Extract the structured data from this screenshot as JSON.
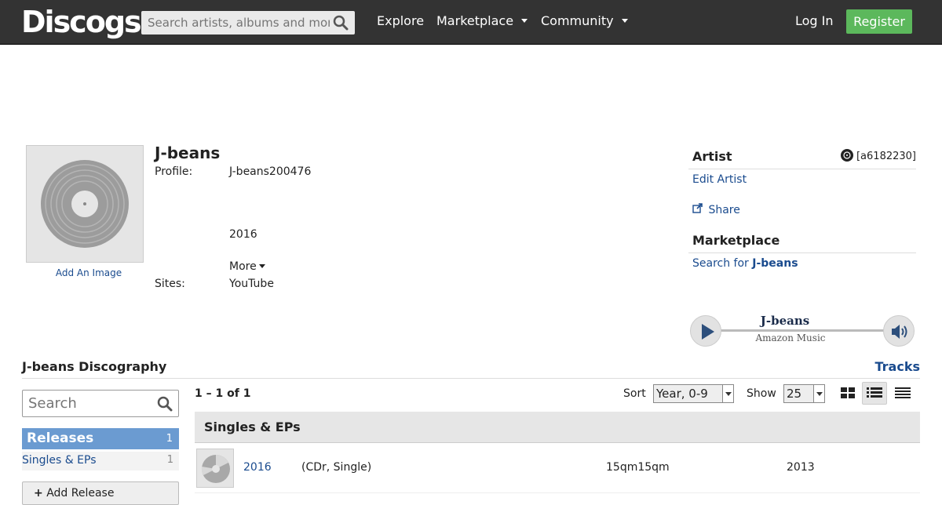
{
  "header": {
    "logo": "Discogs",
    "search_placeholder": "Search artists, albums and more...",
    "nav": [
      {
        "label": "Explore",
        "has_caret": false
      },
      {
        "label": "Marketplace",
        "has_caret": true
      },
      {
        "label": "Community",
        "has_caret": true
      }
    ],
    "login": "Log In",
    "register": "Register"
  },
  "artist": {
    "name": "J-beans",
    "add_image": "Add An Image",
    "profile_label": "Profile:",
    "profile_value": "J-beans200476",
    "profile_year": "2016",
    "more": "More",
    "sites_label": "Sites:",
    "sites_value": "YouTube"
  },
  "sidebar": {
    "artist_heading": "Artist",
    "artist_id": "[a6182230]",
    "edit_artist": "Edit Artist",
    "share": "Share",
    "marketplace_heading": "Marketplace",
    "search_for": "Search for",
    "search_for_name": "J-beans"
  },
  "player": {
    "title": "J-beans",
    "subtitle": "Amazon Music"
  },
  "discography": {
    "title": "J-beans Discography",
    "tracks_link": "Tracks",
    "search_placeholder": "Search",
    "releases_label": "Releases",
    "releases_count": "1",
    "singles_label": "Singles & EPs",
    "singles_count": "1",
    "add_release": "Add Release",
    "pagination": "1 – 1 of 1",
    "sort_label": "Sort",
    "sort_value": "Year, 0-9",
    "show_label": "Show",
    "show_value": "25",
    "section_heading": "Singles & EPs",
    "rows": [
      {
        "title": "2016",
        "format": "(CDr, Single)",
        "label": "15qm15qm",
        "year": "2013"
      }
    ]
  },
  "colors": {
    "topbar": "#333333",
    "register": "#5cb85c",
    "link": "#1a4b8e",
    "releases_active": "#6b9bd1"
  }
}
